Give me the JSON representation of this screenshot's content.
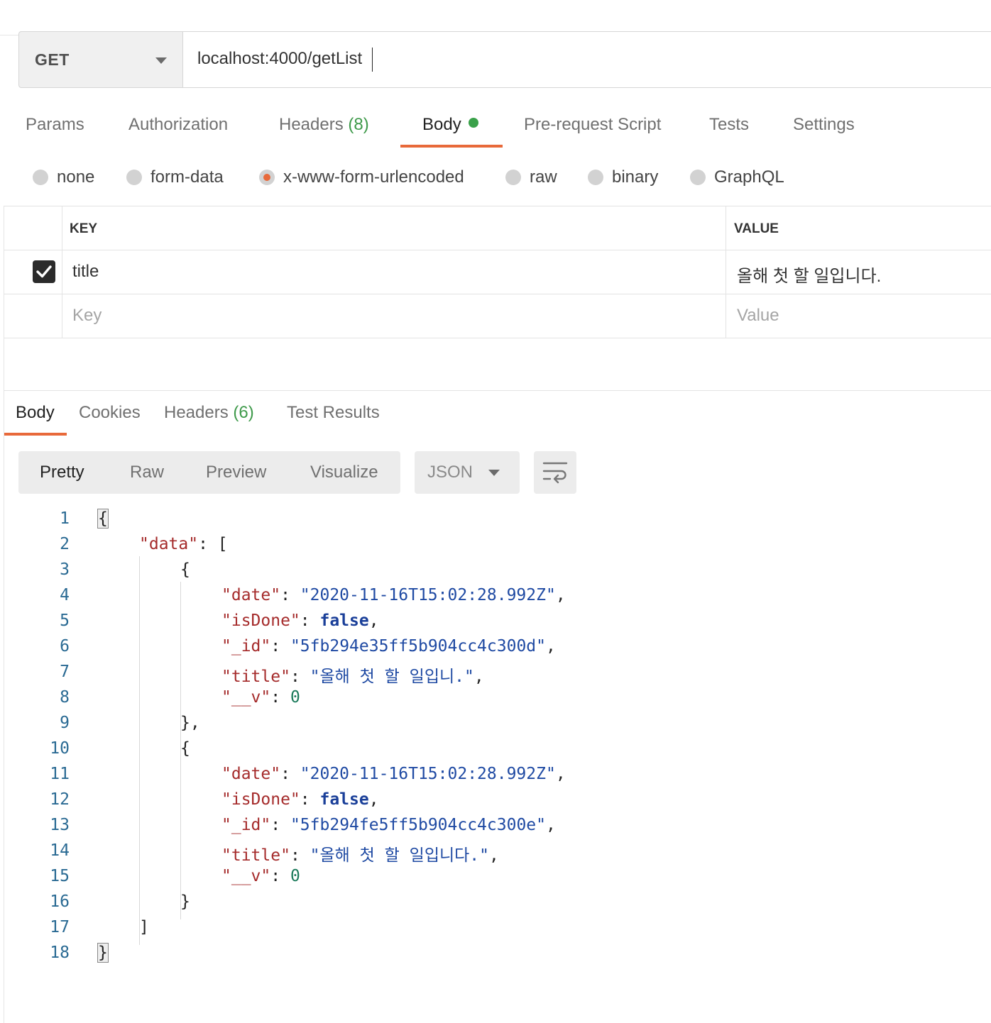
{
  "request": {
    "method": "GET",
    "url": "localhost:4000/getList"
  },
  "request_tabs": [
    {
      "label": "Params"
    },
    {
      "label": "Authorization"
    },
    {
      "label": "Headers",
      "count": "(8)"
    },
    {
      "label": "Body",
      "active": true,
      "indicator": "green-dot"
    },
    {
      "label": "Pre-request Script"
    },
    {
      "label": "Tests"
    },
    {
      "label": "Settings"
    }
  ],
  "body_types": [
    {
      "label": "none"
    },
    {
      "label": "form-data"
    },
    {
      "label": "x-www-form-urlencoded",
      "selected": true
    },
    {
      "label": "raw"
    },
    {
      "label": "binary"
    },
    {
      "label": "GraphQL"
    }
  ],
  "params_table": {
    "headers": {
      "key": "KEY",
      "value": "VALUE"
    },
    "rows": [
      {
        "checked": true,
        "key": "title",
        "value": "올해 첫 할 일입니다."
      }
    ],
    "placeholder": {
      "key": "Key",
      "value": "Value"
    }
  },
  "response_tabs": [
    {
      "label": "Body",
      "active": true
    },
    {
      "label": "Cookies"
    },
    {
      "label": "Headers",
      "count": "(6)"
    },
    {
      "label": "Test Results"
    }
  ],
  "view_modes": [
    {
      "label": "Pretty",
      "active": true
    },
    {
      "label": "Raw"
    },
    {
      "label": "Preview"
    },
    {
      "label": "Visualize"
    }
  ],
  "format": "JSON",
  "icons": {
    "method_dropdown": "chevron-down-icon",
    "format_dropdown": "chevron-down-icon",
    "wrap": "wrap-lines-icon",
    "checkbox": "check-icon"
  },
  "colors": {
    "accent": "#e8693a",
    "status_green": "#3aa14a",
    "json_key": "#a52b2b",
    "json_string": "#1f4aa3",
    "json_number": "#1a7a5a"
  },
  "response_lines": [
    {
      "n": "1",
      "p": [
        "{"
      ]
    },
    {
      "n": "2",
      "p": [
        "\"data\"",
        ": ["
      ]
    },
    {
      "n": "3",
      "p": [
        "{"
      ]
    },
    {
      "n": "4",
      "p": [
        "\"date\"",
        ": ",
        "\"2020-11-16T15:02:28.992Z\"",
        ","
      ]
    },
    {
      "n": "5",
      "p": [
        "\"isDone\"",
        ": ",
        "false",
        ","
      ]
    },
    {
      "n": "6",
      "p": [
        "\"_id\"",
        ": ",
        "\"5fb294e35ff5b904cc4c300d\"",
        ","
      ]
    },
    {
      "n": "7",
      "p": [
        "\"title\"",
        ": ",
        "\"올해 첫 할 일입니.\"",
        ","
      ]
    },
    {
      "n": "8",
      "p": [
        "\"__v\"",
        ": ",
        "0"
      ]
    },
    {
      "n": "9",
      "p": [
        "},"
      ]
    },
    {
      "n": "10",
      "p": [
        "{"
      ]
    },
    {
      "n": "11",
      "p": [
        "\"date\"",
        ": ",
        "\"2020-11-16T15:02:28.992Z\"",
        ","
      ]
    },
    {
      "n": "12",
      "p": [
        "\"isDone\"",
        ": ",
        "false",
        ","
      ]
    },
    {
      "n": "13",
      "p": [
        "\"_id\"",
        ": ",
        "\"5fb294fe5ff5b904cc4c300e\"",
        ","
      ]
    },
    {
      "n": "14",
      "p": [
        "\"title\"",
        ": ",
        "\"올해 첫 할 일입니다.\"",
        ","
      ]
    },
    {
      "n": "15",
      "p": [
        "\"__v\"",
        ": ",
        "0"
      ]
    },
    {
      "n": "16",
      "p": [
        "}"
      ]
    },
    {
      "n": "17",
      "p": [
        "]"
      ]
    },
    {
      "n": "18",
      "p": [
        "}"
      ]
    }
  ]
}
